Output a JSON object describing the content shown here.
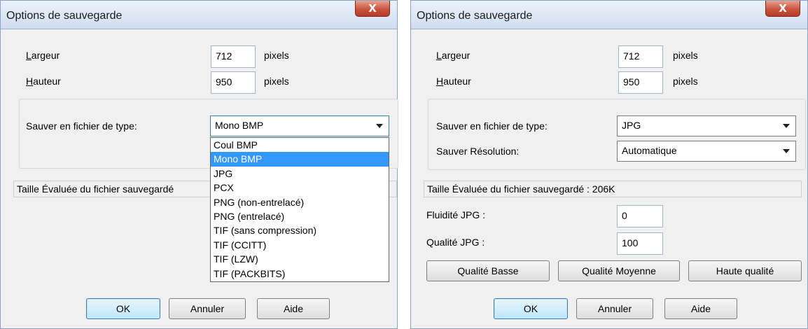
{
  "left_dialog": {
    "title": "Options de sauvegarde",
    "close_label": "X",
    "width_label_u": "L",
    "width_label_rest": "argeur",
    "width_value": "712",
    "width_unit": "pixels",
    "height_label_u": "H",
    "height_label_rest": "auteur",
    "height_value": "950",
    "height_unit": "pixels",
    "save_type_label": "Sauver en fichier de type:",
    "save_type_value": "Mono BMP",
    "file_types": [
      "Coul BMP",
      "Mono BMP",
      "JPG",
      "PCX",
      "PNG (non-entrelacé)",
      "PNG (entrelacé)",
      "TIF (sans compression)",
      "TIF (CCITT)",
      "TIF (LZW)",
      "TIF (PACKBITS)"
    ],
    "selected_file_type_index": 1,
    "estimated_size": "Taille Évaluée du fichier sauvegardé",
    "ok_label": "OK",
    "cancel_label": "Annuler",
    "help_label": "Aide"
  },
  "right_dialog": {
    "title": "Options de sauvegarde",
    "close_label": "X",
    "width_label_u": "L",
    "width_label_rest": "argeur",
    "width_value": "712",
    "width_unit": "pixels",
    "height_label_u": "H",
    "height_label_rest": "auteur",
    "height_value": "950",
    "height_unit": "pixels",
    "save_type_label": "Sauver en fichier de type:",
    "save_type_value": "JPG",
    "resolution_label": "Sauver Résolution:",
    "resolution_value": "Automatique",
    "estimated_size": "Taille Évaluée du fichier sauvegardé : 206K",
    "jpg_smoothness_label": "Fluidité JPG :",
    "jpg_smoothness_value": "0",
    "jpg_quality_label": "Qualité JPG :",
    "jpg_quality_value": "100",
    "low_quality_label": "Qualité Basse",
    "medium_quality_label": "Qualité Moyenne",
    "high_quality_label": "Haute qualité",
    "ok_label": "OK",
    "cancel_label": "Annuler",
    "help_label": "Aide"
  }
}
